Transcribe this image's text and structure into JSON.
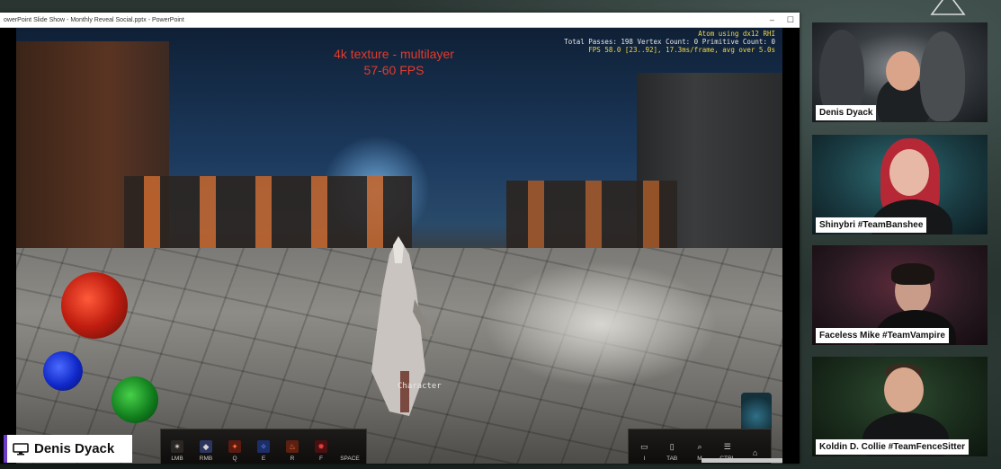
{
  "window": {
    "title": "owerPoint Slide Show  -  Monthly Reveal Social.pptx  -  PowerPoint",
    "minimize": "–",
    "maximize": "☐"
  },
  "slide": {
    "heading_line1": "4k texture - multilayer",
    "heading_line2": "57-60 FPS",
    "debug_line1": "Atom using dx12 RHI",
    "debug_line2": "Total Passes: 198 Vertex Count: 0 Primitive Count: 0",
    "debug_line3": "FPS 58.0 [23..92], 17.3ms/frame, avg over 5.0s",
    "character_label": "Character",
    "hud_left": [
      {
        "key": "LMB",
        "icon": "claw-icon"
      },
      {
        "key": "RMB",
        "icon": "shield-icon"
      },
      {
        "key": "Q",
        "icon": "fire-icon"
      },
      {
        "key": "E",
        "icon": "ice-icon"
      },
      {
        "key": "R",
        "icon": "flame-icon"
      },
      {
        "key": "F",
        "icon": "blood-icon"
      },
      {
        "key": "SPACE",
        "icon": "empty-icon"
      }
    ],
    "hud_right": [
      {
        "key": "I",
        "icon": "inventory-icon"
      },
      {
        "key": "TAB",
        "icon": "phone-icon"
      },
      {
        "key": "M",
        "icon": "map-search-icon"
      },
      {
        "key": "CTRL",
        "icon": "menu-icon"
      },
      {
        "key": "",
        "icon": "camera-icon"
      }
    ]
  },
  "participants": [
    {
      "name": "Denis Dyack"
    },
    {
      "name": "Shinybri #TeamBanshee"
    },
    {
      "name": "Faceless Mike #TeamVampire"
    },
    {
      "name": "Koldin D. Collie #TeamFenceSitter"
    }
  ],
  "speaker": {
    "name": "Denis Dyack"
  },
  "colors": {
    "heading_red": "#e53a2b",
    "badge_accent": "#6a3dc8",
    "debug_yellow": "#f2d64a"
  }
}
